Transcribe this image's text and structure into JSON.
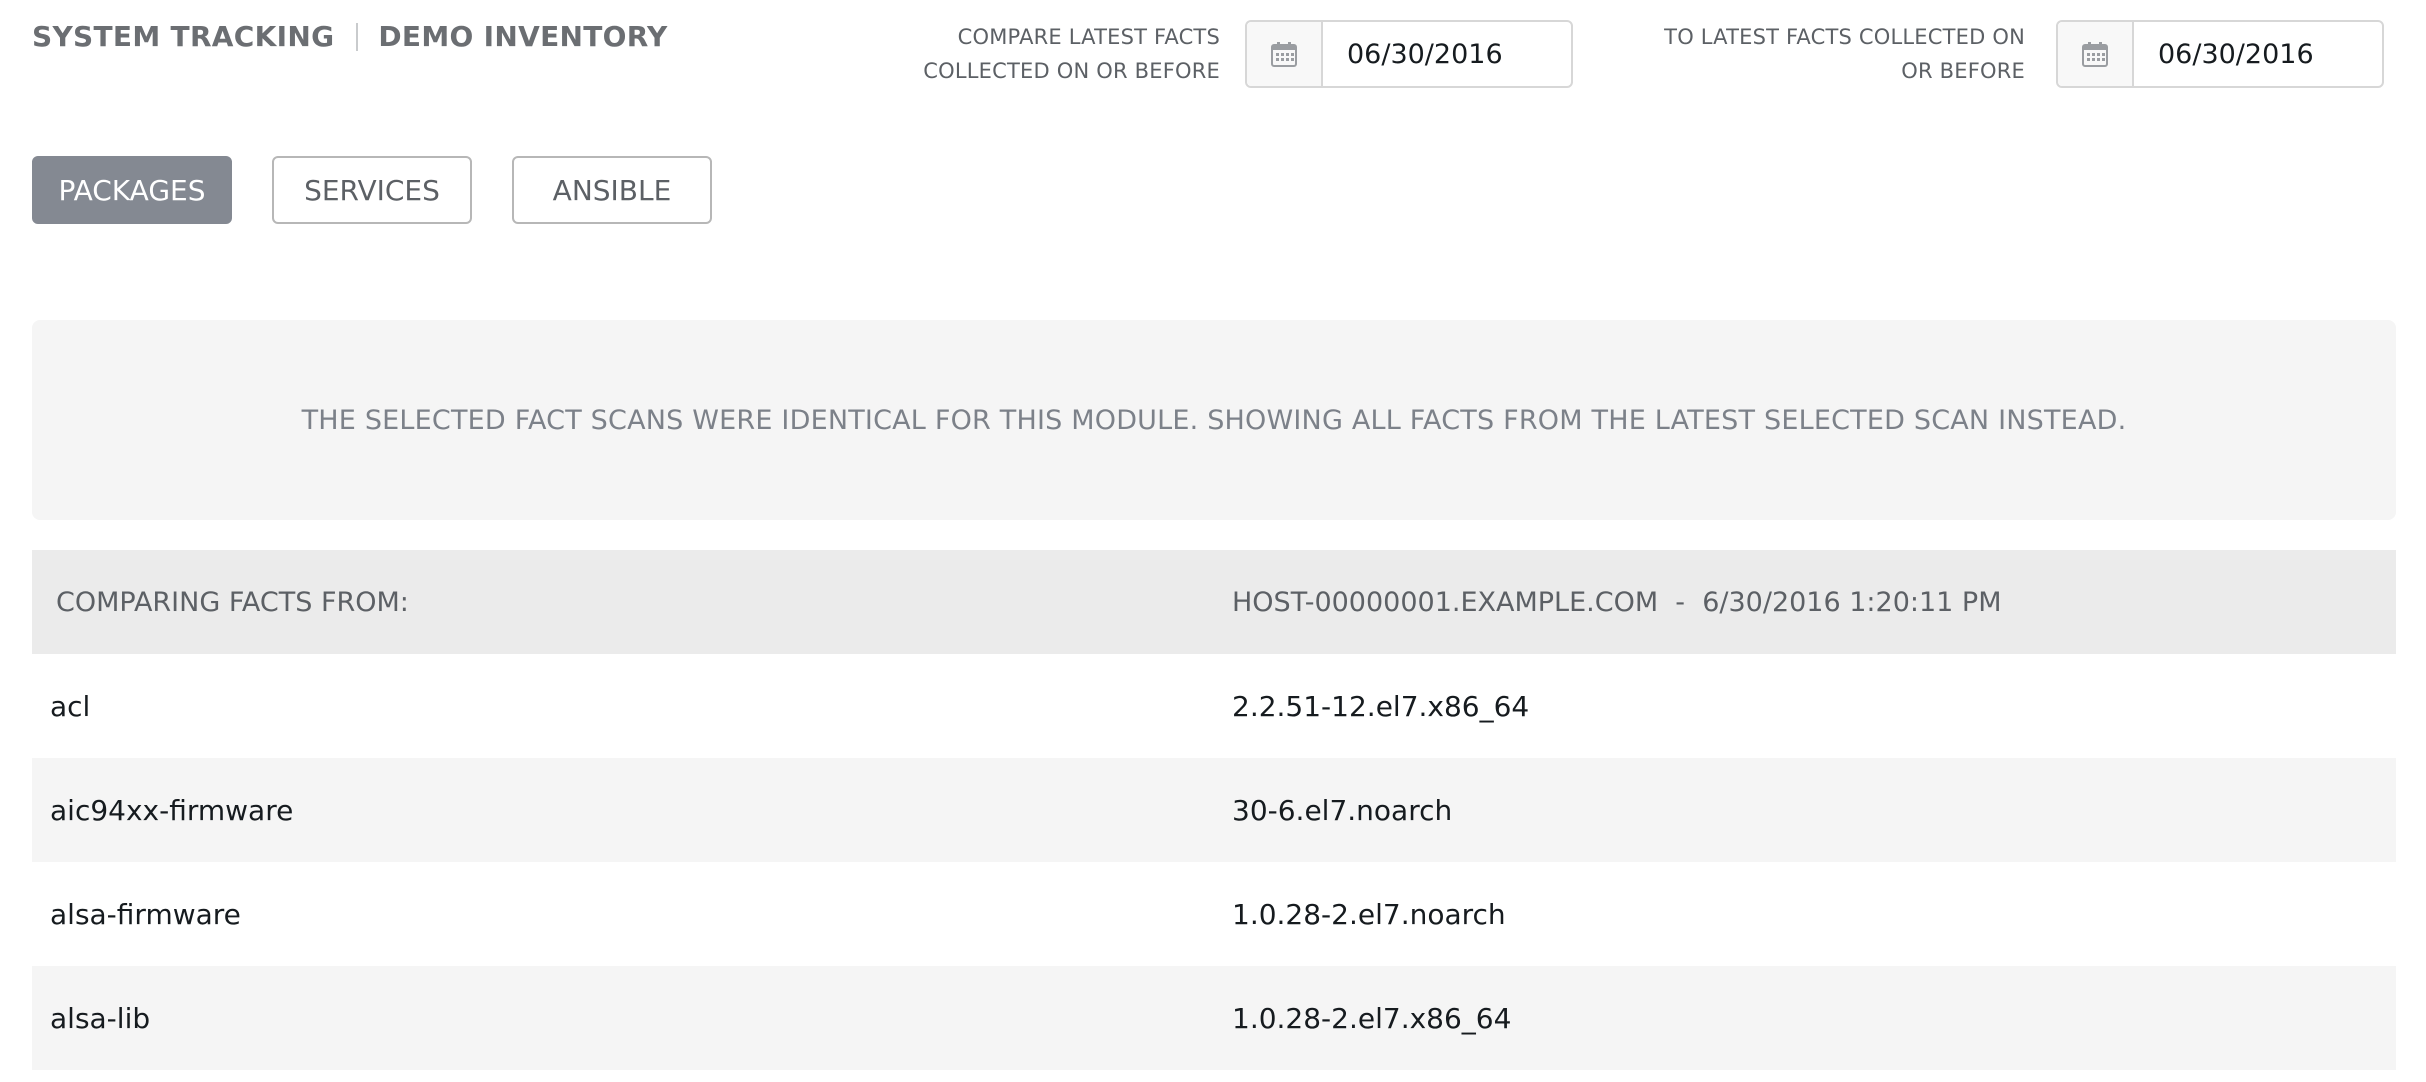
{
  "header": {
    "section_title": "SYSTEM TRACKING",
    "inventory_name": "DEMO INVENTORY"
  },
  "date_filters": {
    "compare": {
      "label": "COMPARE LATEST FACTS COLLECTED ON OR BEFORE",
      "value": "06/30/2016",
      "icon": "calendar-icon"
    },
    "to": {
      "label": "TO LATEST FACTS COLLECTED ON OR BEFORE",
      "value": "06/30/2016",
      "icon": "calendar-icon"
    }
  },
  "tabs": [
    {
      "label": "PACKAGES",
      "active": true
    },
    {
      "label": "SERVICES",
      "active": false
    },
    {
      "label": "ANSIBLE",
      "active": false
    }
  ],
  "notice": {
    "message": "THE SELECTED FACT SCANS WERE IDENTICAL FOR THIS MODULE. SHOWING ALL FACTS FROM THE LATEST SELECTED SCAN INSTEAD."
  },
  "table": {
    "header_left": "COMPARING FACTS FROM:",
    "header_right": "HOST-00000001.EXAMPLE.COM  -  6/30/2016 1:20:11 PM",
    "rows": [
      {
        "name": "acl",
        "version": "2.2.51-12.el7.x86_64"
      },
      {
        "name": "aic94xx-firmware",
        "version": "30-6.el7.noarch"
      },
      {
        "name": "alsa-firmware",
        "version": "1.0.28-2.el7.noarch"
      },
      {
        "name": "alsa-lib",
        "version": "1.0.28-2.el7.x86_64"
      }
    ]
  },
  "colors": {
    "active_tab": "#848992",
    "notice_bg": "#f5f5f5",
    "table_header_bg": "#ebebeb"
  }
}
